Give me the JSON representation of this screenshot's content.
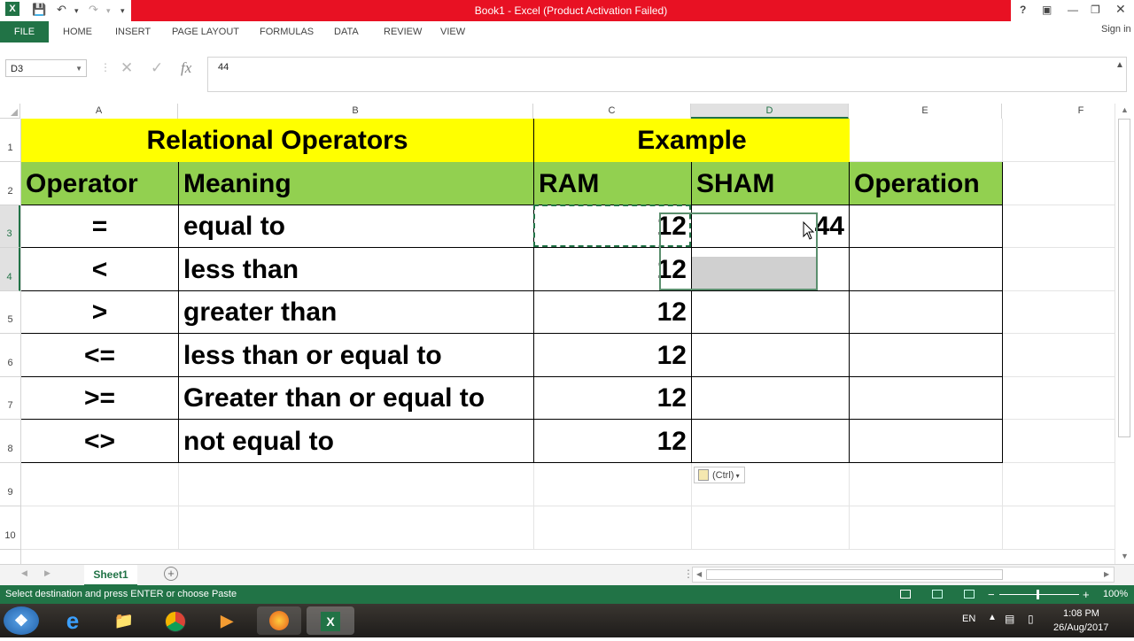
{
  "window": {
    "title": "Book1 - Excel (Product Activation Failed)",
    "help": "?",
    "sign_in": "Sign in"
  },
  "ribbon_tabs": [
    "FILE",
    "HOME",
    "INSERT",
    "PAGE LAYOUT",
    "FORMULAS",
    "DATA",
    "REVIEW",
    "VIEW"
  ],
  "formula_bar": {
    "name_box": "D3",
    "fx": "fx",
    "value": "44"
  },
  "columns": [
    "A",
    "B",
    "C",
    "D",
    "E",
    "F"
  ],
  "rows": [
    "1",
    "2",
    "3",
    "4",
    "5",
    "6",
    "7",
    "8",
    "9",
    "10"
  ],
  "sheet": {
    "header1": {
      "title": "Relational Operators",
      "example": "Example"
    },
    "header2": {
      "operator": "Operator",
      "meaning": "Meaning",
      "ram": "RAM",
      "sham": "SHAM",
      "operation": "Operation"
    },
    "rows": [
      {
        "op": "=",
        "meaning": "equal to",
        "ram": "12",
        "sham": "44"
      },
      {
        "op": "<",
        "meaning": "less than",
        "ram": "12",
        "sham": ""
      },
      {
        "op": ">",
        "meaning": "greater than",
        "ram": "12",
        "sham": ""
      },
      {
        "op": "<=",
        "meaning": "less than or equal to",
        "ram": "12",
        "sham": ""
      },
      {
        "op": ">=",
        "meaning": "Greater than or equal to",
        "ram": "12",
        "sham": ""
      },
      {
        "op": "<>",
        "meaning": "not equal to",
        "ram": "12",
        "sham": ""
      }
    ],
    "header_yellow": "#ffff00",
    "header_green": "#92d050"
  },
  "paste_options": "(Ctrl)",
  "sheet_tab": "Sheet1",
  "status": {
    "message": "Select destination and press ENTER or choose Paste",
    "zoom": "100%"
  },
  "taskbar": {
    "lang": "EN",
    "time": "1:08 PM",
    "date": "26/Aug/2017"
  }
}
